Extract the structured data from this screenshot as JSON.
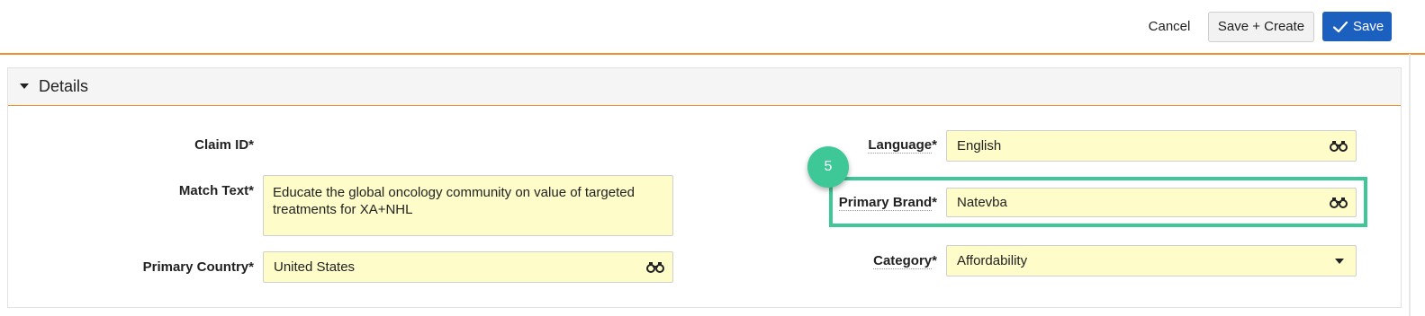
{
  "toolbar": {
    "cancel_label": "Cancel",
    "save_create_label": "Save + Create",
    "save_label": "Save"
  },
  "section": {
    "title": "Details"
  },
  "fields": {
    "claim_id": {
      "label": "Claim ID",
      "required_mark": "*"
    },
    "match_text": {
      "label": "Match Text",
      "required_mark": "*",
      "value": "Educate the global oncology community on value of targeted treatments for XA+NHL"
    },
    "primary_country": {
      "label": "Primary Country",
      "required_mark": "*",
      "value": "United States",
      "icon": "binoculars-icon"
    },
    "language": {
      "label": "Language",
      "required_mark": "*",
      "value": "English",
      "icon": "binoculars-icon"
    },
    "primary_brand": {
      "label": "Primary Brand",
      "required_mark": "*",
      "value": "Natevba",
      "icon": "binoculars-icon"
    },
    "category": {
      "label": "Category",
      "required_mark": "*",
      "value": "Affordability",
      "icon": "dropdown-caret-icon"
    }
  },
  "annotation": {
    "step_number": "5",
    "highlight_color": "#3ec797"
  },
  "colors": {
    "accent_orange": "#f0902a",
    "primary_blue": "#1b5fbf",
    "field_yellow": "#fefcc9"
  }
}
